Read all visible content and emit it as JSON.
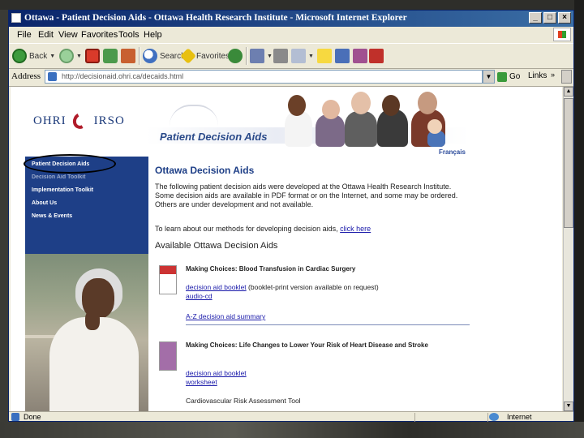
{
  "window": {
    "title": "Ottawa - Patient Decision Aids - Ottawa Health Research Institute - Microsoft Internet Explorer",
    "buttons": [
      "_",
      "□",
      "×"
    ]
  },
  "menubar": {
    "items": [
      "File",
      "Edit",
      "View",
      "Favorites",
      "Tools",
      "Help"
    ]
  },
  "toolbar": {
    "back_label": "Back",
    "search_label": "Search",
    "favorites_label": "Favorites"
  },
  "addressbar": {
    "label": "Address",
    "url": "http://decisionaid.ohri.ca/decaids.html",
    "go_label": "Go",
    "links_label": "Links",
    "links_arrow": "»"
  },
  "page": {
    "logo_left": "OHRI",
    "logo_right": "IRSO",
    "banner_title": "Patient Decision Aids",
    "francais": "Français",
    "nav": [
      "Patient Decision Aids",
      "Decision Aid Toolkit",
      "Implementation Toolkit",
      "About Us",
      "News & Events"
    ],
    "heading": "Ottawa Decision Aids",
    "intro": "The following patient decision aids were developed at the Ottawa Health Research Institute. Some decision aids are available in PDF format or on the Internet, and some may be ordered. Others are under development and not available.",
    "methods_text": "To learn about our methods for developing decision aids,",
    "methods_link": "click here",
    "available_heading": "Available Ottawa Decision Aids",
    "aids": [
      {
        "title": "Making Choices: Blood Transfusion in Cardiac Surgery",
        "line1_link": "decision aid booklet",
        "line1_rest": " (booklet-print version available on request)",
        "line2_link": "audio-cd",
        "line3_link": "A-Z decision aid summary"
      },
      {
        "title": "Making Choices: Life Changes to Lower Your Risk of Heart Disease and Stroke",
        "line1_link": "decision aid booklet",
        "line2_link": "worksheet",
        "line3": "Cardiovascular Risk Assessment Tool"
      }
    ]
  },
  "status": {
    "left": "Done",
    "right": "Internet"
  }
}
